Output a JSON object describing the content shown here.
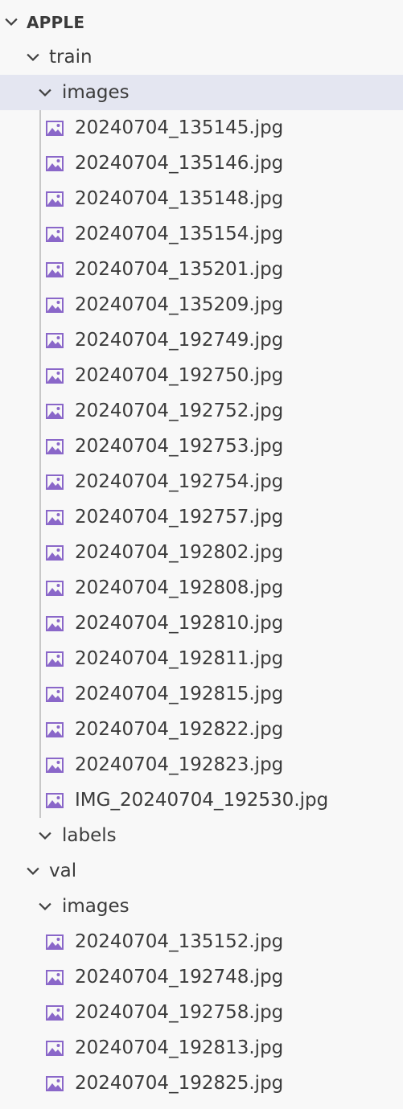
{
  "explorer": {
    "root": {
      "label": "APPLE",
      "expanded": true,
      "icon": "chevron-down-icon"
    },
    "train": {
      "label": "train",
      "images": {
        "label": "images",
        "files": [
          "20240704_135145.jpg",
          "20240704_135146.jpg",
          "20240704_135148.jpg",
          "20240704_135154.jpg",
          "20240704_135201.jpg",
          "20240704_135209.jpg",
          "20240704_192749.jpg",
          "20240704_192750.jpg",
          "20240704_192752.jpg",
          "20240704_192753.jpg",
          "20240704_192754.jpg",
          "20240704_192757.jpg",
          "20240704_192802.jpg",
          "20240704_192808.jpg",
          "20240704_192810.jpg",
          "20240704_192811.jpg",
          "20240704_192815.jpg",
          "20240704_192822.jpg",
          "20240704_192823.jpg",
          "IMG_20240704_192530.jpg"
        ]
      },
      "labels": {
        "label": "labels"
      }
    },
    "val": {
      "label": "val",
      "images": {
        "label": "images",
        "files": [
          "20240704_135152.jpg",
          "20240704_192748.jpg",
          "20240704_192758.jpg",
          "20240704_192813.jpg",
          "20240704_192825.jpg"
        ]
      }
    }
  },
  "colors": {
    "background": "#f8f8f8",
    "selected_row": "#e4e6f1",
    "image_icon": "#8a67c9",
    "text": "#3b3b3b",
    "indent_guide": "#c8c8c8"
  }
}
